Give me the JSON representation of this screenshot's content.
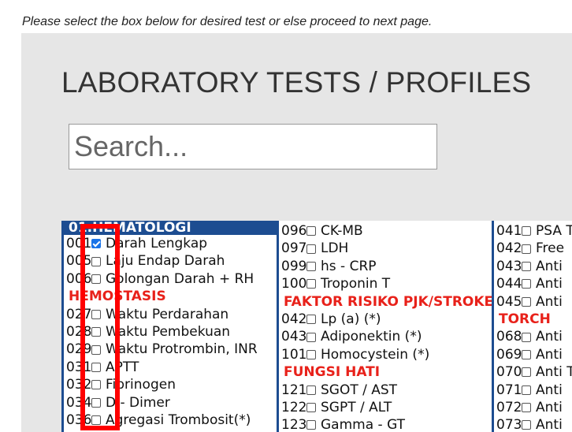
{
  "instruction": "Please select the box below for desired test or else proceed to next page.",
  "title": "LABORATORY TESTS / PROFILES",
  "search": {
    "placeholder": "Search..."
  },
  "columns": [
    {
      "header": "01.HEMATOLOGI",
      "rows": [
        {
          "type": "test",
          "code": "001",
          "label": "Darah Lengkap",
          "checked": true
        },
        {
          "type": "test",
          "code": "005",
          "label": "Laju Endap Darah",
          "checked": false
        },
        {
          "type": "test",
          "code": "006",
          "label": "Golongan Darah + RH",
          "checked": false
        },
        {
          "type": "category",
          "label": "HEMOSTASIS"
        },
        {
          "type": "test",
          "code": "027",
          "label": "Waktu Perdarahan",
          "checked": false
        },
        {
          "type": "test",
          "code": "028",
          "label": "Waktu Pembekuan",
          "checked": false
        },
        {
          "type": "test",
          "code": "029",
          "label": "Waktu Protrombin, INR",
          "checked": false
        },
        {
          "type": "test",
          "code": "031",
          "label": "APTT",
          "checked": false
        },
        {
          "type": "test",
          "code": "032",
          "label": "Fibrinogen",
          "checked": false
        },
        {
          "type": "test",
          "code": "034",
          "label": "D - Dimer",
          "checked": false
        },
        {
          "type": "test",
          "code": "036",
          "label": "Agregasi Trombosit(*)",
          "checked": false
        }
      ]
    },
    {
      "header": "",
      "rows": [
        {
          "type": "test",
          "code": "096",
          "label": "CK-MB",
          "checked": false
        },
        {
          "type": "test",
          "code": "097",
          "label": "LDH",
          "checked": false
        },
        {
          "type": "test",
          "code": "099",
          "label": "hs - CRP",
          "checked": false
        },
        {
          "type": "test",
          "code": "100",
          "label": "Troponin T",
          "checked": false
        },
        {
          "type": "category",
          "label": "FAKTOR RISIKO PJK/STROKE"
        },
        {
          "type": "test",
          "code": "042",
          "label": "Lp (a) (*)",
          "checked": false
        },
        {
          "type": "test",
          "code": "043",
          "label": "Adiponektin (*)",
          "checked": false
        },
        {
          "type": "test",
          "code": "101",
          "label": "Homocystein (*)",
          "checked": false
        },
        {
          "type": "category",
          "label": "FUNGSI HATI"
        },
        {
          "type": "test",
          "code": "121",
          "label": "SGOT / AST",
          "checked": false
        },
        {
          "type": "test",
          "code": "122",
          "label": "SGPT / ALT",
          "checked": false
        },
        {
          "type": "test",
          "code": "123",
          "label": "Gamma - GT",
          "checked": false
        }
      ]
    },
    {
      "header": "",
      "rows": [
        {
          "type": "test",
          "code": "041",
          "label": "PSA T",
          "checked": false
        },
        {
          "type": "test",
          "code": "042",
          "label": "Free",
          "checked": false
        },
        {
          "type": "test",
          "code": "043",
          "label": "Anti",
          "checked": false
        },
        {
          "type": "test",
          "code": "044",
          "label": "Anti",
          "checked": false
        },
        {
          "type": "test",
          "code": "045",
          "label": "Anti",
          "checked": false
        },
        {
          "type": "category",
          "label": "TORCH"
        },
        {
          "type": "test",
          "code": "068",
          "label": "Anti",
          "checked": false
        },
        {
          "type": "test",
          "code": "069",
          "label": "Anti",
          "checked": false
        },
        {
          "type": "test",
          "code": "070",
          "label": "Anti To",
          "checked": false
        },
        {
          "type": "test",
          "code": "071",
          "label": "Anti",
          "checked": false
        },
        {
          "type": "test",
          "code": "072",
          "label": "Anti",
          "checked": false
        },
        {
          "type": "test",
          "code": "073",
          "label": "Anti",
          "checked": false
        }
      ]
    }
  ],
  "colors": {
    "header_bg": "#1d4d91",
    "category": "#e8211a",
    "highlight": "#ff0000",
    "checkbox_checked": "#1a73e8"
  }
}
